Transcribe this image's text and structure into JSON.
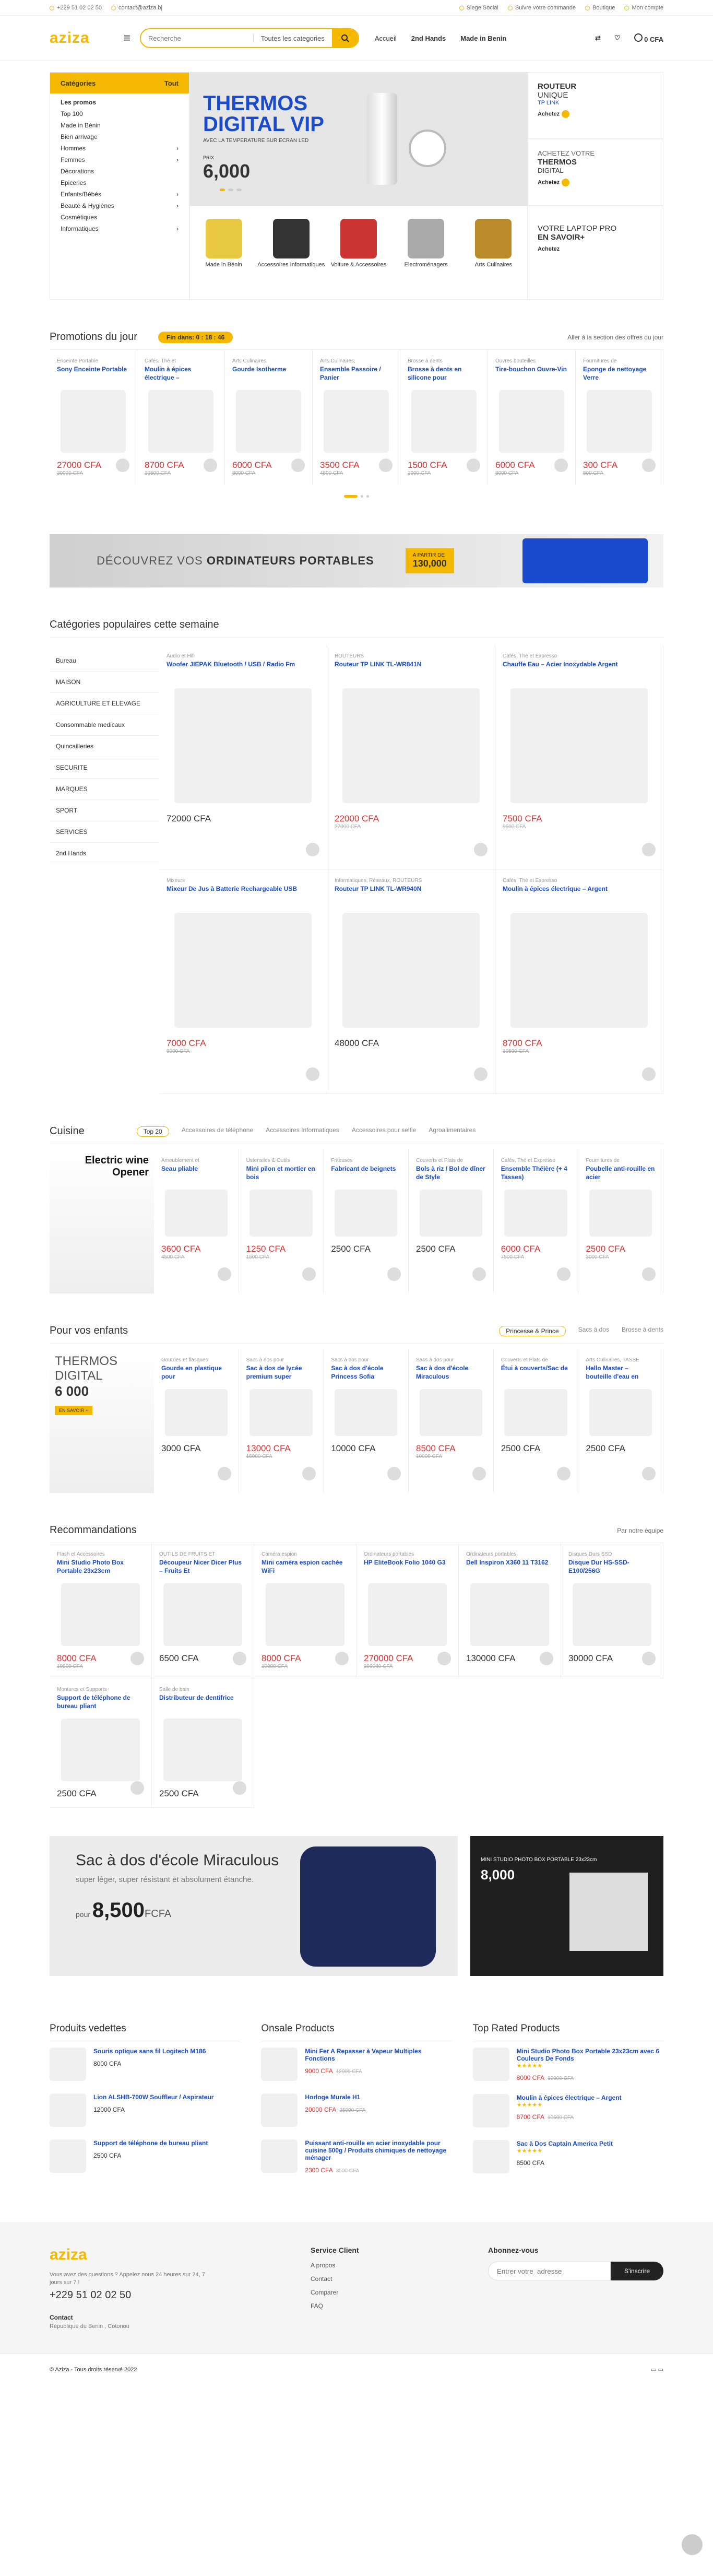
{
  "topbar": {
    "phone": "+229 51 02 02 50",
    "email": "contact@aziza.bj",
    "links": [
      "Siege Social",
      "Suivre votre commande",
      "Boutique",
      "Mon compte"
    ]
  },
  "header": {
    "logo": "aziza",
    "search_placeholder": "Recherche",
    "search_cat": "Toutes les categories",
    "nav": [
      "Accueil",
      "2nd Hands",
      "Made in Benin"
    ],
    "cart": "0 CFA"
  },
  "menu": {
    "title": "Catégories",
    "all": "Tout",
    "items": [
      "Les promos",
      "Top 100",
      "Made in Bénin",
      "Bien arrivage",
      "Hommes",
      "Femmes",
      "Décorations",
      "Epiceries",
      "Enfants/Bébés",
      "Beauté & Hygiènes",
      "Cosmétiques",
      "Informatiques"
    ]
  },
  "hero": {
    "title1": "THERMOS",
    "title2": "DIGITAL VIP",
    "sub": "AVEC LA TEMPERATURE SUR ECRAN LED",
    "price_label": "PRIX",
    "price": "6,000",
    "side": [
      {
        "a": "ROUTEUR",
        "b": "UNIQUE",
        "c": "TP LINK",
        "btn": "Achetez"
      },
      {
        "a": "ACHETEZ VOTRE",
        "b": "THERMOS",
        "c": "DIGITAL",
        "btn": "Achetez"
      }
    ],
    "feats": [
      "Made in Bénin",
      "Accessoires Informatiques",
      "Voiture & Accessoires",
      "Electroménagers",
      "Arts Culinaires"
    ],
    "side3": {
      "a": "VOTRE LAPTOP PRO",
      "b": "EN SAVOIR+",
      "btn": "Achetez"
    }
  },
  "promo": {
    "title": "Promotions du jour",
    "timer": "Fin dans:  0 : 18 : 46",
    "more": "Aller à la section des offres du jour",
    "items": [
      {
        "c": "Enceinte Portable",
        "n": "Sony Enceinte Portable",
        "p": "27000 CFA",
        "o": "30000 CFA"
      },
      {
        "c": "Cafés, Thé et",
        "n": "Moulin à épices électrique –",
        "p": "8700 CFA",
        "o": "10500 CFA"
      },
      {
        "c": "Arts Culinaires,",
        "n": "Gourde Isotherme",
        "p": "6000 CFA",
        "o": "8000 CFA"
      },
      {
        "c": "Arts Culinaires,",
        "n": "Ensemble Passoire / Panier",
        "p": "3500 CFA",
        "o": "4500 CFA"
      },
      {
        "c": "Brosse à dents",
        "n": "Brosse à dents en silicone pour",
        "p": "1500 CFA",
        "o": "2000 CFA"
      },
      {
        "c": "Ouvres bouteilles",
        "n": "Tire-bouchon Ouvre-Vin",
        "p": "6000 CFA",
        "o": "8000 CFA"
      },
      {
        "c": "Fournitures de",
        "n": "Eponge de nettoyage Verre",
        "p": "300 CFA",
        "o": "500 CFA"
      }
    ]
  },
  "laptop": {
    "a": "DÉCOUVREZ VOS",
    "b": "ORDINATEURS PORTABLES",
    "tag": "A PARTIR DE",
    "price": "130,000"
  },
  "popular": {
    "title": "Catégories populaires cette semaine",
    "cats": [
      "Bureau",
      "MAISON",
      "AGRICULTURE ET ELEVAGE",
      "Consommable medicaux",
      "Quincailleries",
      "SECURITE",
      "MARQUES",
      "SPORT",
      "SERVICES",
      "2nd Hands"
    ],
    "items": [
      {
        "c": "Audio et Hifi",
        "n": "Woofer JIEPAK Bluetooth / USB / Radio Fm",
        "p": "72000 CFA",
        "o": ""
      },
      {
        "c": "ROUTEURS",
        "n": "Routeur TP LINK TL-WR841N",
        "p": "22000 CFA",
        "o": "27000 CFA"
      },
      {
        "c": "Cafés, Thé et Expresso",
        "n": "Chauffe Eau – Acier Inoxydable Argent",
        "p": "7500 CFA",
        "o": "9500 CFA"
      },
      {
        "c": "Mixeurs",
        "n": "Mixeur De Jus à Batterie Rechargeable USB",
        "p": "7000 CFA",
        "o": "9000 CFA"
      },
      {
        "c": "Informatiques, Réseaux, ROUTEURS",
        "n": "Routeur TP LINK TL-WR940N",
        "p": "48000 CFA",
        "o": ""
      },
      {
        "c": "Cafés, Thé et Expresso",
        "n": "Moulin à épices électrique – Argent",
        "p": "8700 CFA",
        "o": "10500 CFA"
      }
    ]
  },
  "cuisine": {
    "title": "Cuisine",
    "tabs": [
      "Top 20",
      "Accessoires de téléphone",
      "Accessoires Informatiques",
      "Accessoires pour selfie",
      "Agroalimentaires"
    ],
    "banner": "Electric wine Opener",
    "items": [
      {
        "c": "Ameublement et",
        "n": "Seau pliable",
        "p": "3600 CFA",
        "o": "4500 CFA"
      },
      {
        "c": "Ustensiles & Outils",
        "n": "Mini pilon et mortier en bois",
        "p": "1250 CFA",
        "o": "1500 CFA"
      },
      {
        "c": "Friteuses",
        "n": "Fabricant de beignets",
        "p": "2500 CFA",
        "o": ""
      },
      {
        "c": "Couverts et Plats de",
        "n": "Bols à riz / Bol de dîner de Style",
        "p": "2500 CFA",
        "o": ""
      },
      {
        "c": "Cafés, Thé et Expresso",
        "n": "Ensemble Théière (+ 4 Tasses)",
        "p": "6000 CFA",
        "o": "7500 CFA"
      },
      {
        "c": "Fournitures de",
        "n": "Poubelle anti-rouille en acier",
        "p": "2500 CFA",
        "o": "3000 CFA"
      }
    ]
  },
  "kids": {
    "title": "Pour vos enfants",
    "tabs": [
      "Princesse & Prince",
      "Sacs à dos",
      "Brosse à dents"
    ],
    "b1": "THERMOS",
    "b2": "DIGITAL",
    "b3": "6 000",
    "b4": "EN SAVOIR +",
    "items": [
      {
        "c": "Gourdes et flasques",
        "n": "Gourde en plastique pour",
        "p": "3000 CFA",
        "o": ""
      },
      {
        "c": "Sacs à dos pour",
        "n": "Sac à dos de lycée premium super",
        "p": "13000 CFA",
        "o": "15000 CFA"
      },
      {
        "c": "Sacs à dos pour",
        "n": "Sac à dos d'école Princess Sofia",
        "p": "10000 CFA",
        "o": ""
      },
      {
        "c": "Sacs à dos pour",
        "n": "Sac à dos d'école Miraculous",
        "p": "8500 CFA",
        "o": "10000 CFA"
      },
      {
        "c": "Couverts et Plats de",
        "n": "Étui à couverts/Sac de",
        "p": "2500 CFA",
        "o": ""
      },
      {
        "c": "Arts Culinaires, TASSE",
        "n": "Hello Master – bouteille d'eau en",
        "p": "2500 CFA",
        "o": ""
      }
    ]
  },
  "reco": {
    "title": "Recommandations",
    "more": "Par notre équipe",
    "items": [
      {
        "c": "Flash et Accessoires",
        "n": "Mini Studio Photo Box Portable 23x23cm",
        "p": "8000 CFA",
        "o": "10000 CFA"
      },
      {
        "c": "OUTILS DE FRUITS ET",
        "n": "Découpeur Nicer Dicer Plus – Fruits Et",
        "p": "6500 CFA",
        "o": ""
      },
      {
        "c": "Caméra espion",
        "n": "Mini caméra espion cachée WiFi",
        "p": "8000 CFA",
        "o": "10000 CFA"
      },
      {
        "c": "Ordinateurs portables",
        "n": "HP EliteBook Folio 1040 G3",
        "p": "270000 CFA",
        "o": "300000 CFA"
      },
      {
        "c": "Ordinateurs portables",
        "n": "Dell Inspiron X360 11 T3162",
        "p": "130000 CFA",
        "o": ""
      },
      {
        "c": "Disques Durs SSD",
        "n": "Disque Dur HS-SSD-E100/256G",
        "p": "30000 CFA",
        "o": ""
      },
      {
        "c": "Montures et Supports",
        "n": "Support de téléphone de bureau pliant",
        "p": "2500 CFA",
        "o": ""
      },
      {
        "c": "Salle de bain",
        "n": "Distributeur de dentifrice",
        "p": "2500 CFA",
        "o": ""
      }
    ]
  },
  "bb": {
    "title": "Sac à dos d'école Miraculous",
    "sub": "super léger, super résistant et absolument étanche.",
    "pour": "pour",
    "price": "8,500",
    "cur": "FCFA",
    "b2a": "MINI STUDIO PHOTO BOX PORTABLE 23x23cm",
    "b2b": "8,000"
  },
  "lists": [
    {
      "title": "Produits vedettes",
      "items": [
        {
          "n": "Souris optique sans fil Logitech M186",
          "p": "8000 CFA",
          "o": ""
        },
        {
          "n": "Lion ALSHB-700W Souffleur / Aspirateur",
          "p": "12000 CFA",
          "o": ""
        },
        {
          "n": "Support de téléphone de bureau pliant",
          "p": "2500 CFA",
          "o": ""
        }
      ]
    },
    {
      "title": "Onsale Products",
      "items": [
        {
          "n": "Mini Fer A Repasser à Vapeur Multiples Fonctions",
          "p": "9000 CFA",
          "o": "12000 CFA"
        },
        {
          "n": "Horloge Murale H1",
          "p": "20000 CFA",
          "o": "25000 CFA"
        },
        {
          "n": "Puissant anti-rouille en acier inoxydable pour cuisine 500g / Produits chimiques de nettoyage ménager",
          "p": "2300 CFA",
          "o": "3500 CFA"
        }
      ]
    },
    {
      "title": "Top Rated Products",
      "items": [
        {
          "n": "Mini Studio Photo Box Portable 23x23cm avec 6 Couleurs De Fonds",
          "p": "8000 CFA",
          "o": "10000 CFA"
        },
        {
          "n": "Moulin à épices électrique – Argent",
          "p": "8700 CFA",
          "o": "10500 CFA"
        },
        {
          "n": "Sac à Dos Captain America Petit",
          "p": "8500 CFA",
          "o": ""
        }
      ]
    }
  ],
  "footer": {
    "logo": "aziza",
    "q": "Vous avez des questions ? Appelez nous 24 heures sur 24, 7 jours sur 7 !",
    "phone": "+229 51 02 02 50",
    "contact": "Contact",
    "addr": "République du Benin , Cotonou",
    "svc": "Service Client",
    "links": [
      "A propos",
      "Contact",
      "Comparer",
      "FAQ"
    ],
    "nl": "Abonnez-vous",
    "nl_ph": "Entrer votre  adresse",
    "nl_btn": "S'inscrire",
    "copy": "© Aziza - Tous droits réservé 2022"
  }
}
